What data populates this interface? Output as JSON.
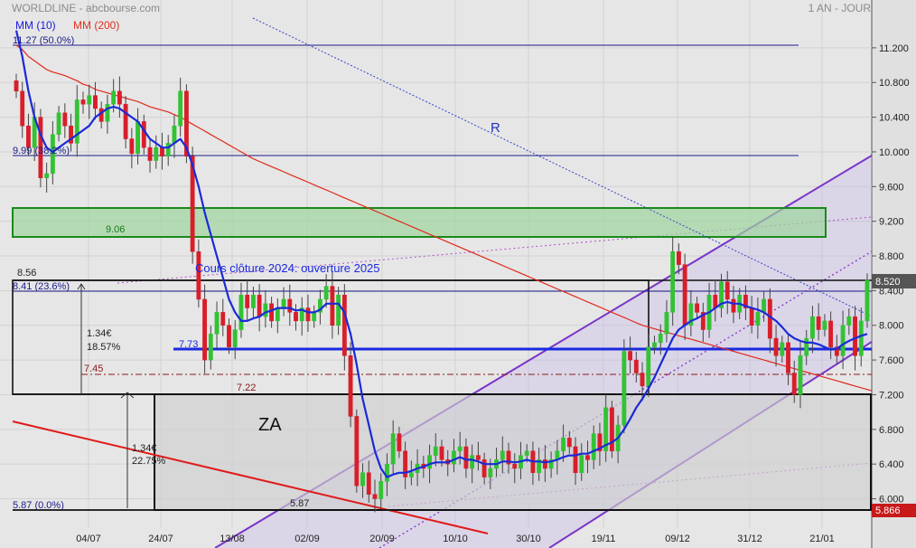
{
  "header": {
    "ticker_source": "WORLDLINE - abcbourse.com",
    "period": "1 AN - JOUR",
    "legend": [
      {
        "label": "MM (10)",
        "color": "#1a1adc"
      },
      {
        "label": "MM (200)",
        "color": "#e03020"
      }
    ]
  },
  "colors": {
    "up": "#33c233",
    "down": "#d81e2a",
    "mm10": "#1a2ad8",
    "mm200": "#e02a1c",
    "channel": "#7a35c8",
    "fib": "#1a1a8a"
  },
  "chart_data": {
    "type": "candlestick",
    "ylim": [
      5.866,
      11.45
    ],
    "y_ticks": [
      6.0,
      6.4,
      6.8,
      7.2,
      7.6,
      8.0,
      8.4,
      8.8,
      9.2,
      9.6,
      10.0,
      10.4,
      10.8,
      11.2
    ],
    "y_tick_labels": [
      "6.000",
      "6.400",
      "6.800",
      "7.200",
      "7.600",
      "8.000",
      "8.400",
      "8.800",
      "9.200",
      "9.600",
      "10.000",
      "10.400",
      "10.800",
      "11.200"
    ],
    "x_tick_labels": [
      "04/07",
      "24/07",
      "13/08",
      "02/09",
      "20/09",
      "10/10",
      "30/10",
      "19/11",
      "09/12",
      "31/12",
      "21/01"
    ],
    "last_price": "8.520",
    "low_marker": "5.866",
    "fib_levels": [
      {
        "label": "11.27  (50.0%)",
        "value": 11.23
      },
      {
        "label": "9.99  (38.2%)",
        "value": 9.97
      },
      {
        "label": "8.41  (23.6%)",
        "value": 8.39
      },
      {
        "label": "5.87  (0.0%)",
        "value": 5.87
      }
    ],
    "annotations": {
      "r_label": "R",
      "cloture": "Cours clôture 2024: ouverture 2025",
      "za_label": "ZA",
      "zone_906": "9.06",
      "level_856": "8.56",
      "level_773": "7.73",
      "level_745": "7.45",
      "level_722": "7.22",
      "level_587": "5.87",
      "measure1_value": "1.34€",
      "measure1_pct": "18.57%",
      "measure2_value": "1.34€",
      "measure2_pct": "22.75%"
    },
    "closes": [
      10.7,
      10.3,
      10.05,
      10.4,
      9.7,
      9.75,
      10.2,
      10.45,
      10.3,
      10.1,
      10.6,
      10.55,
      10.65,
      10.5,
      10.35,
      10.55,
      10.7,
      10.55,
      10.15,
      9.98,
      10.35,
      10.05,
      9.9,
      10.05,
      9.95,
      10.1,
      10.3,
      10.7,
      9.95,
      8.85,
      8.3,
      7.6,
      7.9,
      8.15,
      8.0,
      7.75,
      7.95,
      8.35,
      8.2,
      8.35,
      8.1,
      8.25,
      8.05,
      8.2,
      8.3,
      8.15,
      8.05,
      8.2,
      8.05,
      8.15,
      8.3,
      8.45,
      8.0,
      8.35,
      7.65,
      6.95,
      6.15,
      6.3,
      6.05,
      6.0,
      6.2,
      6.4,
      6.75,
      6.55,
      6.25,
      6.3,
      6.4,
      6.35,
      6.5,
      6.6,
      6.45,
      6.4,
      6.55,
      6.6,
      6.35,
      6.5,
      6.45,
      6.25,
      6.35,
      6.45,
      6.55,
      6.4,
      6.35,
      6.5,
      6.55,
      6.3,
      6.45,
      6.35,
      6.45,
      6.55,
      6.7,
      6.6,
      6.3,
      6.5,
      6.45,
      6.75,
      6.55,
      7.05,
      6.55,
      6.85,
      7.7,
      7.6,
      7.45,
      7.3,
      7.75,
      7.8,
      7.9,
      8.15,
      8.85,
      8.7,
      8.0,
      8.25,
      8.15,
      7.95,
      8.35,
      8.2,
      8.5,
      8.3,
      8.15,
      8.35,
      8.2,
      8.0,
      8.15,
      8.3,
      7.85,
      7.65,
      7.8,
      7.45,
      7.2,
      7.65,
      7.85,
      8.1,
      7.95,
      8.05,
      7.75,
      7.65,
      8.0,
      8.1,
      7.65,
      8.05,
      8.52
    ],
    "mm10": [
      11.4,
      11.1,
      10.7,
      10.4,
      10.2,
      10.05,
      10.0,
      10.05,
      10.1,
      10.15,
      10.2,
      10.25,
      10.3,
      10.4,
      10.45,
      10.5,
      10.52,
      10.5,
      10.45,
      10.4,
      10.35,
      10.25,
      10.15,
      10.1,
      10.05,
      10.05,
      10.1,
      10.15,
      10.05,
      9.85,
      9.6,
      9.3,
      9.05,
      8.8,
      8.55,
      8.3,
      8.15,
      8.05,
      8.05,
      8.08,
      8.1,
      8.15,
      8.17,
      8.2,
      8.2,
      8.2,
      8.17,
      8.18,
      8.15,
      8.15,
      8.18,
      8.25,
      8.25,
      8.25,
      8.15,
      7.9,
      7.55,
      7.15,
      6.85,
      6.55,
      6.35,
      6.25,
      6.28,
      6.3,
      6.3,
      6.32,
      6.35,
      6.37,
      6.4,
      6.42,
      6.42,
      6.42,
      6.45,
      6.48,
      6.45,
      6.45,
      6.43,
      6.4,
      6.4,
      6.4,
      6.43,
      6.43,
      6.42,
      6.43,
      6.45,
      6.43,
      6.43,
      6.42,
      6.43,
      6.45,
      6.48,
      6.5,
      6.5,
      6.52,
      6.52,
      6.55,
      6.58,
      6.62,
      6.65,
      6.7,
      6.8,
      6.92,
      7.05,
      7.15,
      7.27,
      7.4,
      7.55,
      7.7,
      7.85,
      7.95,
      8.0,
      8.05,
      8.08,
      8.12,
      8.15,
      8.2,
      8.25,
      8.27,
      8.25,
      8.25,
      8.22,
      8.2,
      8.18,
      8.15,
      8.1,
      8.05,
      7.98,
      7.9,
      7.85,
      7.82,
      7.8,
      7.8,
      7.78,
      7.75,
      7.72,
      7.73,
      7.78,
      7.82,
      7.85,
      7.88,
      7.9
    ],
    "mm200": [
      11.23,
      11.18,
      11.1,
      11.05,
      11.0,
      10.95,
      10.92,
      10.9,
      10.88,
      10.85,
      10.82,
      10.78,
      10.76,
      10.72,
      10.7,
      10.68,
      10.66,
      10.64,
      10.62,
      10.6,
      10.58,
      10.55,
      10.52,
      10.5,
      10.48,
      10.46,
      10.43,
      10.4,
      10.36,
      10.32,
      10.28,
      10.24,
      10.2,
      10.16,
      10.12,
      10.08,
      10.04,
      10.0,
      9.96,
      9.92,
      9.89,
      9.86,
      9.83,
      9.8,
      9.77,
      9.74,
      9.71,
      9.68,
      9.65,
      9.62,
      9.59,
      9.56,
      9.53,
      9.5,
      9.47,
      9.44,
      9.41,
      9.38,
      9.35,
      9.32,
      9.29,
      9.26,
      9.23,
      9.2,
      9.17,
      9.14,
      9.11,
      9.08,
      9.05,
      9.02,
      8.99,
      8.96,
      8.93,
      8.9,
      8.87,
      8.84,
      8.81,
      8.78,
      8.75,
      8.72,
      8.69,
      8.66,
      8.63,
      8.6,
      8.57,
      8.54,
      8.51,
      8.48,
      8.45,
      8.42,
      8.39,
      8.36,
      8.33,
      8.3,
      8.27,
      8.24,
      8.21,
      8.18,
      8.15,
      8.12,
      8.09,
      8.06,
      8.03,
      8.0,
      7.98,
      7.96,
      7.94,
      7.92,
      7.9,
      7.88,
      7.86,
      7.84,
      7.82,
      7.8,
      7.78,
      7.76,
      7.74,
      7.72,
      7.7,
      7.68,
      7.66,
      7.64,
      7.62,
      7.6,
      7.58,
      7.56,
      7.54,
      7.52,
      7.5,
      7.48,
      7.46,
      7.44,
      7.42,
      7.4,
      7.38,
      7.36,
      7.34,
      7.32,
      7.3,
      7.28,
      7.26,
      7.24
    ]
  }
}
